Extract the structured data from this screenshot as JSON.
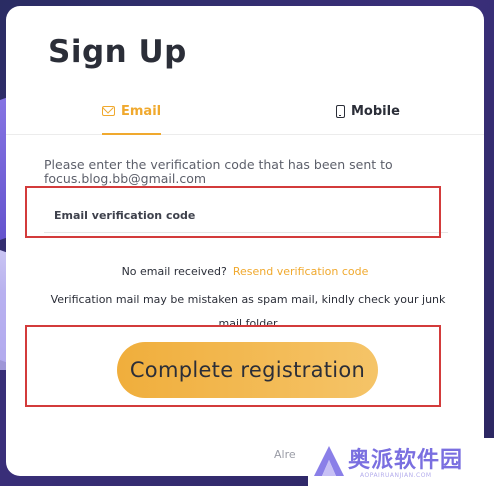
{
  "modal": {
    "title": "Sign Up"
  },
  "tabs": [
    {
      "label": "Email",
      "icon": "mail-icon",
      "active": true
    },
    {
      "label": "Mobile",
      "icon": "phone-icon",
      "active": false
    }
  ],
  "verification": {
    "instruction": "Please enter the verification code that has been sent to focus.blog.bb@gmail.com",
    "code_placeholder": "Email verification code",
    "code_value": ""
  },
  "resend": {
    "prompt": "No email received?",
    "link_label": "Resend verification code"
  },
  "spam_note": "Verification mail may be mistaken as spam mail, kindly check your junk mail folder",
  "actions": {
    "complete_label": "Complete registration"
  },
  "footer": {
    "login_hint_partial": "Alre"
  },
  "watermark": {
    "brand": "奥派软件园",
    "sub": "AOPAIRUANJIAN.COM"
  },
  "colors": {
    "accent": "#f0a92e",
    "highlight_box": "#d33b3b",
    "button_gradient_start": "#f0ae3c",
    "button_gradient_end": "#f5c468"
  }
}
